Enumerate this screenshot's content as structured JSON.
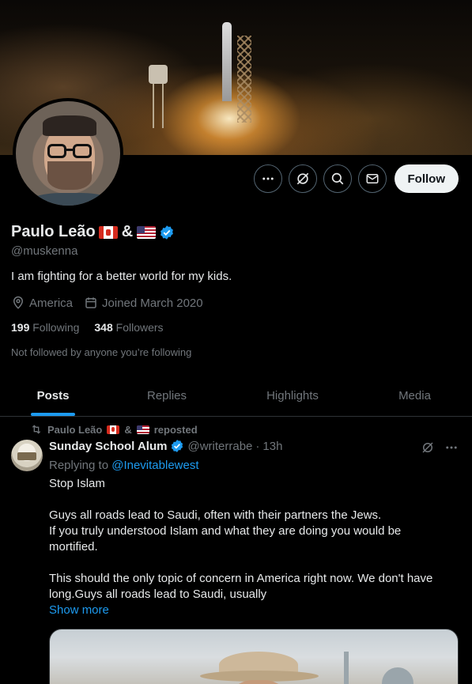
{
  "profile": {
    "display_name": "Paulo Leão",
    "amp": "&",
    "handle": "@muskenna",
    "bio": "I am fighting for a better world for my kids.",
    "location": "America",
    "joined": "Joined March 2020",
    "following_count": "199",
    "following_label": "Following",
    "followers_count": "348",
    "followers_label": "Followers",
    "not_followed_text": "Not followed by anyone you’re following"
  },
  "actions": {
    "follow_label": "Follow"
  },
  "tabs": [
    {
      "label": "Posts"
    },
    {
      "label": "Replies"
    },
    {
      "label": "Highlights"
    },
    {
      "label": "Media"
    }
  ],
  "tweet": {
    "repost_name": "Paulo Leão",
    "repost_amp": "&",
    "repost_suffix": "reposted",
    "author_name": "Sunday School Alum",
    "author_handle": "@writerrabe",
    "separator": "·",
    "time": "13h",
    "replying_prefix": "Replying to",
    "replying_handle": "@Inevitablewest",
    "line1": "Stop Islam",
    "line2": "Guys all roads lead to Saudi, often with their partners the Jews.",
    "line3": "If you truly understood Islam and what they are doing you would be mortified.",
    "line4": "This should the only topic of concern in America right now. We don't have long.Guys all roads lead to Saudi, usually",
    "show_more": "Show more"
  },
  "colors": {
    "accent": "#1d9bf0",
    "background": "#000000",
    "text_primary": "#e7e9ea",
    "text_secondary": "#71767b",
    "follow_button_bg": "#eff3f4"
  }
}
